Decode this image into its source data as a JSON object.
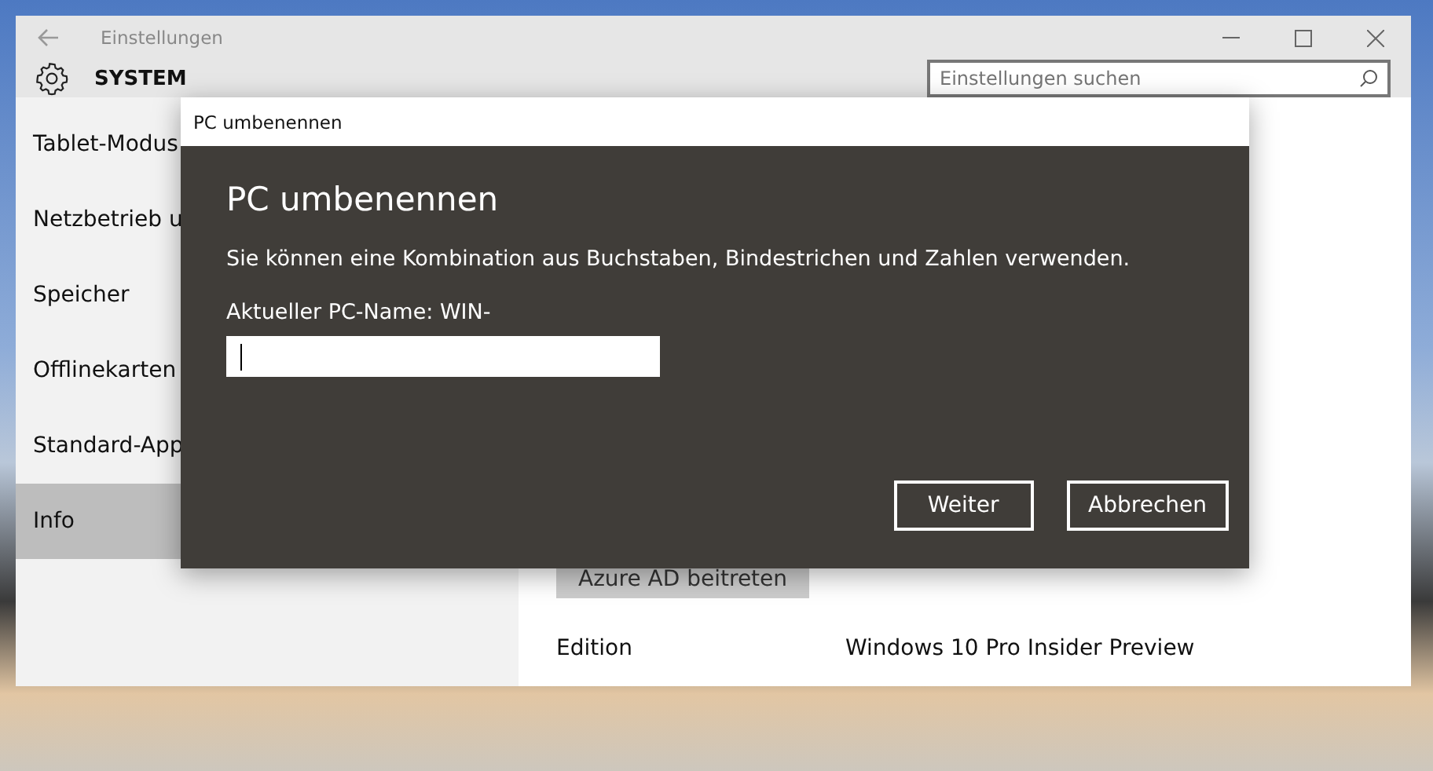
{
  "window": {
    "title": "Einstellungen",
    "section": "SYSTEM",
    "search": {
      "placeholder": "Einstellungen suchen"
    }
  },
  "sidebar": {
    "items": [
      {
        "label": "Tablet-Modus",
        "selected": false
      },
      {
        "label": "Netzbetrieb u",
        "selected": false
      },
      {
        "label": "Speicher",
        "selected": false
      },
      {
        "label": "Offlinekarten",
        "selected": false
      },
      {
        "label": "Standard-App",
        "selected": false
      },
      {
        "label": "Info",
        "selected": true
      }
    ]
  },
  "content": {
    "button": "Azure AD beitreten",
    "rows": [
      {
        "label": "Edition",
        "value": "Windows 10 Pro Insider Preview"
      }
    ]
  },
  "dialog": {
    "title": "PC umbenennen",
    "heading": "PC umbenennen",
    "message": "Sie können eine Kombination aus Buchstaben, Bindestrichen und Zahlen verwenden.",
    "current_name": "Aktueller PC-Name: WIN-",
    "buttons": [
      "Weiter",
      "Abbrechen"
    ]
  }
}
